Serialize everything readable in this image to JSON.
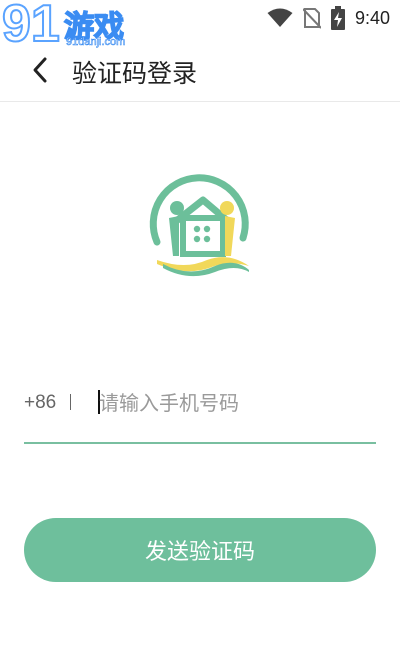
{
  "watermark": {
    "number": "91",
    "name": "游戏",
    "url": "91danji.com"
  },
  "status_bar": {
    "time": "9:40",
    "icons": [
      "wifi-icon",
      "no-sim-icon",
      "battery-charging-icon"
    ]
  },
  "header": {
    "title": "验证码登录",
    "back_icon": "chevron-left-icon"
  },
  "logo": {
    "icon": "house-people-logo",
    "colors": {
      "green": "#6cbf9a",
      "yellow": "#f1d85a"
    }
  },
  "phone": {
    "country_code": "+86",
    "placeholder": "请输入手机号码",
    "value": ""
  },
  "actions": {
    "send_code_label": "发送验证码"
  },
  "theme": {
    "accent": "#6ebf9c",
    "underline": "#79bfa0",
    "text": "#222222"
  }
}
